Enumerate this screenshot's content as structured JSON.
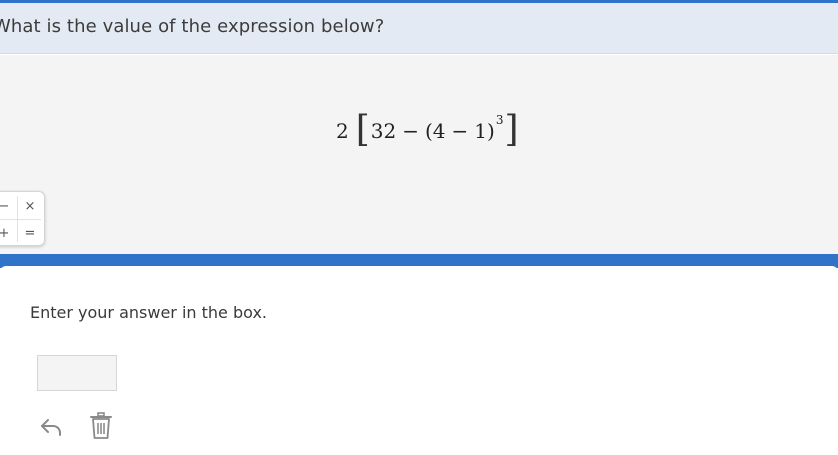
{
  "question": {
    "text": "What is the value of the expression below?"
  },
  "expression": {
    "coefficient": "2",
    "open_bracket": "[",
    "minuend": "32",
    "minus_1": "−",
    "open_paren": "(4",
    "minus_2": "−",
    "inner_close": "1)",
    "exponent": "3",
    "close_bracket": "]"
  },
  "calculator": {
    "keys": [
      "−",
      "×",
      "+",
      "="
    ]
  },
  "response": {
    "instruction": "Enter your answer in the box.",
    "answer_value": "",
    "answer_placeholder": ""
  },
  "icons": {
    "undo": "undo-icon",
    "delete": "trash-icon"
  },
  "colors": {
    "accent": "#2f74c9",
    "question_bg": "#e3eaf3",
    "stimulus_bg": "#f4f4f4",
    "icon": "#8a8a8a"
  }
}
